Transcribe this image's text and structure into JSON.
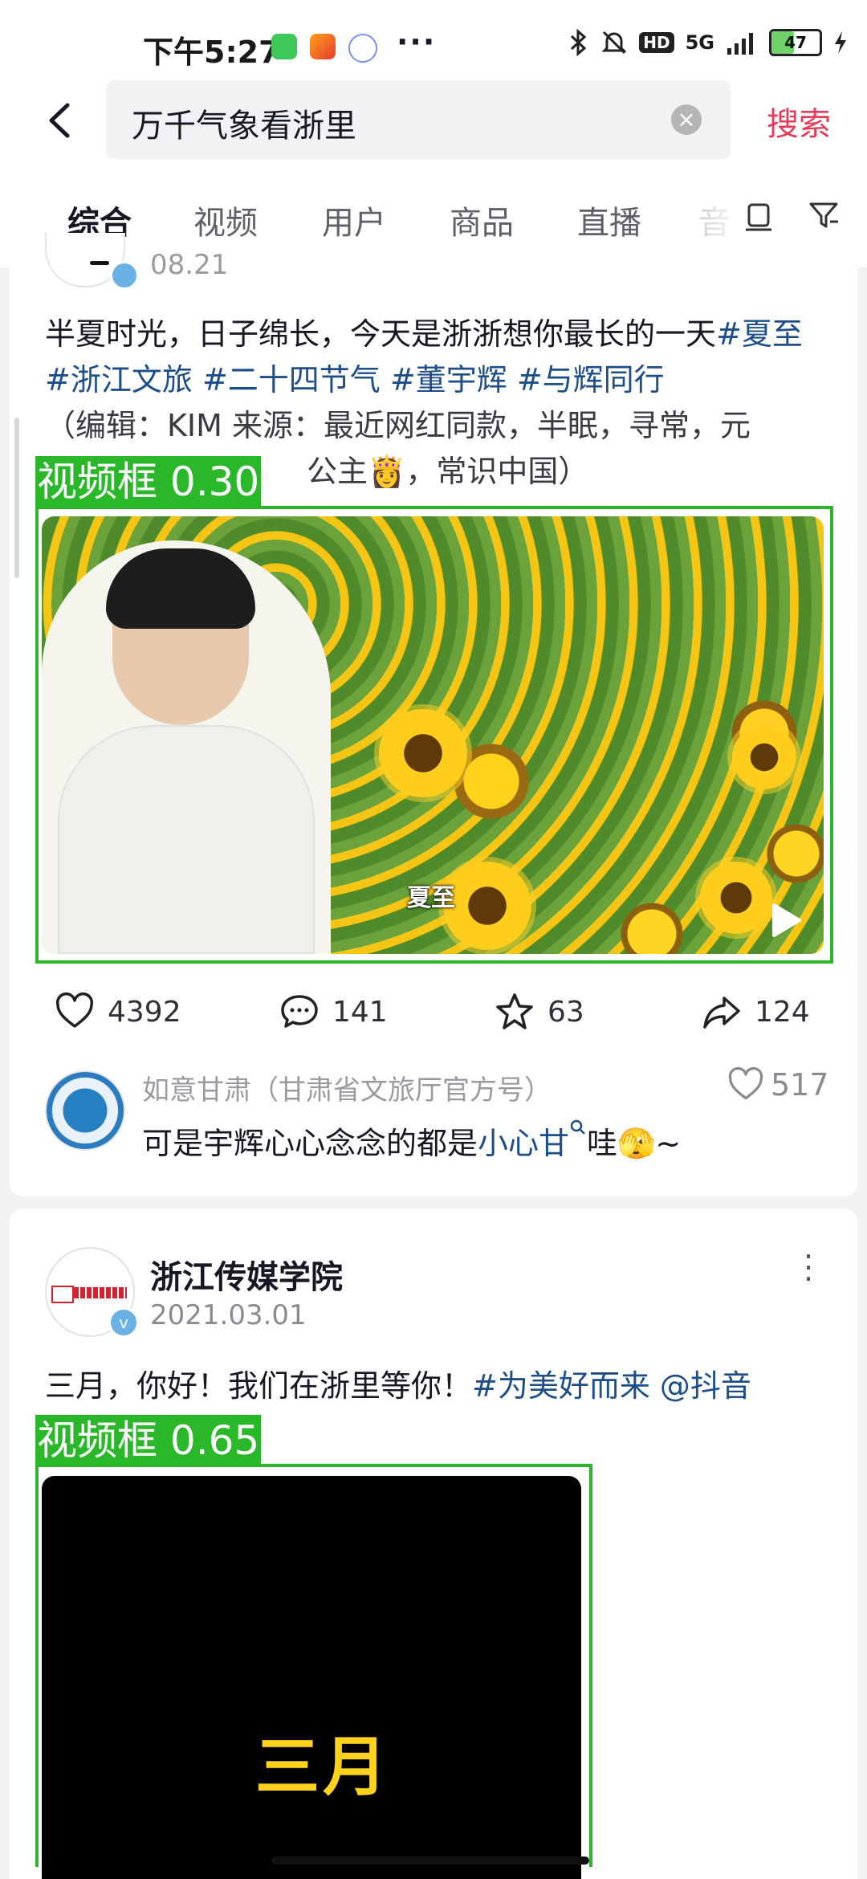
{
  "status_bar": {
    "time": "下午5:27",
    "more": "···",
    "network": "5G",
    "hd": "HD",
    "battery_percent": "47",
    "battery_level": 0.47,
    "icons": [
      "wechat-app-icon",
      "58-app-icon",
      "cloud-app-icon",
      "bluetooth-icon",
      "mute-icon",
      "signal-icon",
      "charging-icon"
    ]
  },
  "search": {
    "query": "万千气象看浙里",
    "button": "搜索"
  },
  "tabs": [
    "综合",
    "视频",
    "用户",
    "商品",
    "直播",
    "音"
  ],
  "post1": {
    "date_partial": "08.21",
    "text_main": "半夏时光，日子绵长，今天是浙浙想你最长的一天",
    "tags": [
      "#夏至",
      "#浙江文旅",
      "#二十四节气",
      "#董宇辉",
      "#与辉同行"
    ],
    "text_source": "（编辑：KIM 来源：最近网红同款，半眠，寻常，元",
    "text_source_2": "公主👸，常识中国）",
    "video_label": "视频框 0.30",
    "video_subtitle": "夏至",
    "likes": "4392",
    "comments": "141",
    "favorites": "63",
    "shares": "124",
    "comment": {
      "user": "如意甘肃（甘肃省文旅厅官方号）",
      "likes": "517",
      "text_before": "可是宇辉心心念念的都是",
      "link": "小心甘",
      "text_after": "哇🫣~"
    }
  },
  "post2": {
    "author": "浙江传媒学院",
    "date": "2021.03.01",
    "text": "三月，你好！我们在浙里等你！",
    "tag": "#为美好而来 @抖音",
    "video_label": "视频框 0.65",
    "video_title": "三月"
  }
}
